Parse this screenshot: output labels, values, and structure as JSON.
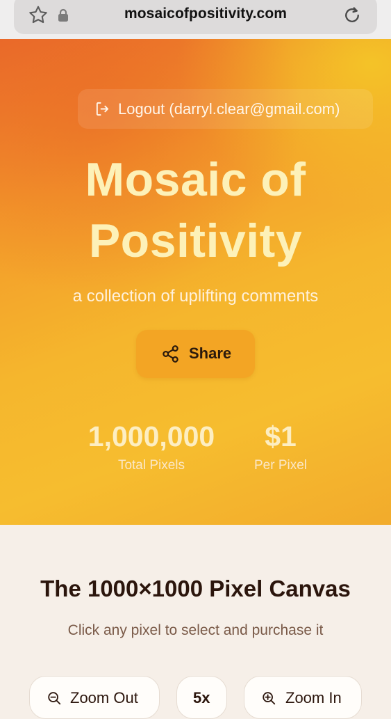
{
  "browser": {
    "url": "mosaicofpositivity.com",
    "icons": [
      "star-icon",
      "lock-icon",
      "reload-icon"
    ]
  },
  "header": {
    "logout_label": "Logout (darryl.clear@gmail.com)",
    "title_line1": "Mosaic of",
    "title_line2": "Positivity",
    "subtitle": "a collection of uplifting comments",
    "share_label": "Share"
  },
  "stats": [
    {
      "value": "1,000,000",
      "label": "Total Pixels"
    },
    {
      "value": "$1",
      "label": "Per Pixel"
    }
  ],
  "canvas": {
    "title": "The 1000×1000 Pixel Canvas",
    "subtitle": "Click any pixel to select and purchase it",
    "zoom_out_label": "Zoom Out",
    "zoom_level": "5x",
    "zoom_in_label": "Zoom In"
  },
  "colors": {
    "hero_gradient_start": "#ea6a2a",
    "hero_gradient_end": "#f6bd2f",
    "title_color": "#fdf1b8",
    "share_button": "#f3a524",
    "page_background": "#f6efe8",
    "heading_text": "#2b150c"
  }
}
